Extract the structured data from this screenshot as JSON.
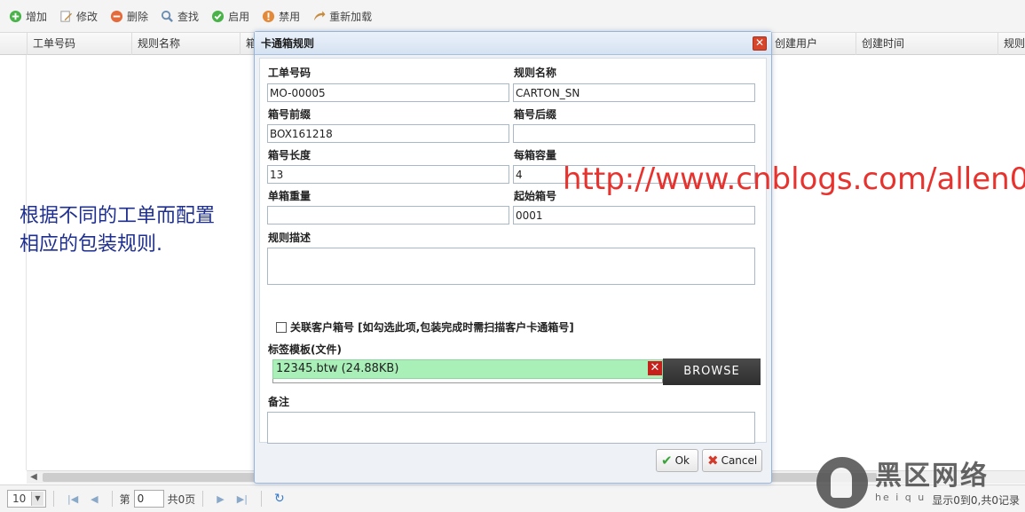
{
  "toolbar": {
    "buttons": [
      {
        "label": "增加",
        "icon": "add-icon",
        "color": "#49b34a"
      },
      {
        "label": "修改",
        "icon": "edit-icon",
        "color": "#c68b3c"
      },
      {
        "label": "删除",
        "icon": "delete-icon",
        "color": "#e46a3a"
      },
      {
        "label": "查找",
        "icon": "search-icon",
        "color": "#6a8cb0"
      },
      {
        "label": "启用",
        "icon": "enable-icon",
        "color": "#49b34a"
      },
      {
        "label": "禁用",
        "icon": "disable-icon",
        "color": "#e28a3a"
      },
      {
        "label": "重新加载",
        "icon": "reload-icon",
        "color": "#c68b3c"
      }
    ]
  },
  "grid": {
    "columns": [
      "工单号码",
      "规则名称",
      "箱",
      "创建用户",
      "创建时间",
      "规则"
    ]
  },
  "pager": {
    "page_size": "10",
    "page_prefix": "第",
    "page_value": "0",
    "page_total": "共0页",
    "info": "显示0到0,共0记录"
  },
  "annotation": {
    "line1": "根据不同的工单而配置",
    "line2": "相应的包装规则."
  },
  "watermark": {
    "url": "http://www.cnblogs.com/allen0",
    "logo_text": "黑区网络",
    "logo_sub": "he i q u"
  },
  "dialog": {
    "title": "卡通箱规则",
    "fields": {
      "mo_number": {
        "label": "工单号码",
        "value": "MO-00005"
      },
      "rule_name": {
        "label": "规则名称",
        "value": "CARTON_SN"
      },
      "box_prefix": {
        "label": "箱号前缀",
        "value": "BOX161218"
      },
      "box_suffix": {
        "label": "箱号后缀",
        "value": ""
      },
      "box_length": {
        "label": "箱号长度",
        "value": "13"
      },
      "box_capacity": {
        "label": "每箱容量",
        "value": "4"
      },
      "box_weight": {
        "label": "单箱重量",
        "value": ""
      },
      "start_no": {
        "label": "起始箱号",
        "value": "0001"
      },
      "rule_desc": {
        "label": "规则描述",
        "value": ""
      },
      "remark": {
        "label": "备注",
        "value": ""
      }
    },
    "checkbox": {
      "label": "关联客户箱号 [如勾选此项,包装完成时需扫描客户卡通箱号]",
      "checked": false
    },
    "template": {
      "label": "标签模板(文件)",
      "file": "12345.btw (24.88KB)",
      "browse_label": "BROWSE"
    },
    "ok_label": "Ok",
    "cancel_label": "Cancel"
  }
}
